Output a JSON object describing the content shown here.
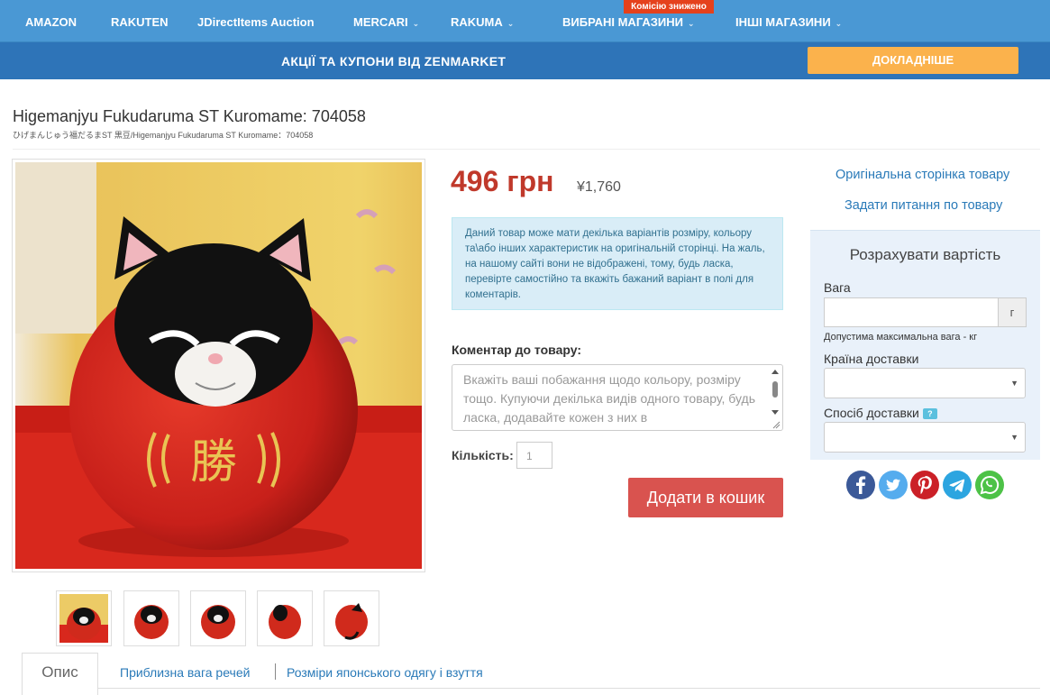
{
  "nav": {
    "items": [
      {
        "label": "AMAZON",
        "caret": false
      },
      {
        "label": "RAKUTEN",
        "caret": false
      },
      {
        "label": "JDirectItems Auction",
        "caret": false
      },
      {
        "label": "MERCARI",
        "caret": true
      },
      {
        "label": "RAKUMA",
        "caret": true
      },
      {
        "label": "ВИБРАНІ МАГАЗИНИ",
        "caret": true
      },
      {
        "label": "ІНШІ МАГАЗИНИ",
        "caret": true
      }
    ],
    "commission_badge": "Комісію знижено"
  },
  "promo": {
    "text": "АКЦІЇ ТА КУПОНИ ВІД ZENMARKET",
    "button": "ДОКЛАДНІШЕ"
  },
  "product": {
    "title": "Higemanjyu Fukudaruma ST Kuromame: 704058",
    "subtitle": "ひげまんじゅう福だるまST 黒豆/Higemanjyu Fukudaruma ST Kuromame：704058",
    "main_image_char": "勝",
    "price": "496 грн",
    "price_yen": "¥1,760",
    "notice": "Даний товар може мати декілька варіантів розміру, кольору та\\або інших характеристик на оригінальній сторінці. На жаль, на нашому сайті вони не відображені, тому, будь ласка, перевірте самостійно та вкажіть бажаний варіант в полі для коментарів.",
    "comment_label": "Коментар до товару:",
    "comment_placeholder": "Вкажіть ваші побажання щодо кольору, розміру тощо. Купуючи декілька видів одного товару, будь ласка, додавайте кожен з них в",
    "quantity_label": "Кількість:",
    "quantity": "1",
    "add_to_cart": "Додати в кошик"
  },
  "sidebar": {
    "original_link": "Оригінальна сторінка товару",
    "ask_link": "Задати питання по товару",
    "calc": {
      "title": "Розрахувати вартість",
      "weight_label": "Вага",
      "weight_unit": "г",
      "weight_hint": "Допустима максимальна вага - кг",
      "country_label": "Країна доставки",
      "method_label": "Спосіб доставки",
      "help": "?"
    },
    "social": [
      "facebook-icon",
      "twitter-icon",
      "pinterest-icon",
      "telegram-icon",
      "whatsapp-icon"
    ]
  },
  "tabs": {
    "active": "Опис",
    "items": [
      "Приблизна вага речей",
      "Розміри японського одягу і взуття"
    ]
  },
  "colors": {
    "nav_bg": "#4a98d4",
    "promo_bg": "#2e74b8",
    "price": "#c0392b",
    "cart_button": "#d9534f",
    "promo_button": "#fbb24c"
  }
}
